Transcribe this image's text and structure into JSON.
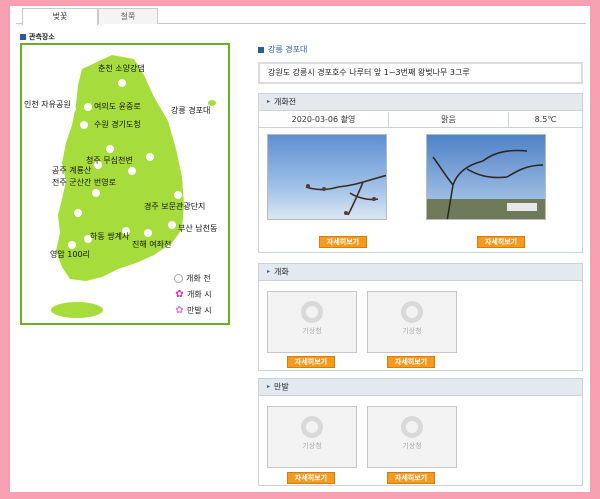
{
  "tabs": [
    {
      "label": "벚꽃",
      "active": true
    },
    {
      "label": "철쭉",
      "active": false
    }
  ],
  "left": {
    "section_label": "관측장소",
    "cities": [
      "춘천 소양강댐",
      "인천 자유공원",
      "여의도 윤중로",
      "강릉 경포대",
      "수원 경기도청",
      "청주 무심천변",
      "공주 계룡산",
      "전주 군산간 번영로",
      "경주 보문관광단지",
      "부산 남천동",
      "하동 쌍계사",
      "진해 여좌천",
      "영암 100리"
    ],
    "legend": [
      {
        "label": "개화 전",
        "marker": "open-circle"
      },
      {
        "label": "개화 시",
        "marker": "flower-icon"
      },
      {
        "label": "만발 시",
        "marker": "flower-icon"
      }
    ],
    "colors": {
      "map_fill": "#a6dd3c",
      "map_border": "#6caf2b",
      "flower": "#d33ab8"
    }
  },
  "right": {
    "title": "강릉 경포대",
    "address": "강원도 강릉시 경포호수 나루터 앞 1~3번째 왕벚나무 3그루",
    "sections": [
      {
        "heading": "개화전",
        "info": {
          "date": "2020-03-06 촬영",
          "weather": "맑음",
          "temp": "8.5℃"
        },
        "items": [
          {
            "button": "자세히보기"
          },
          {
            "button": "자세히보기"
          }
        ]
      },
      {
        "heading": "개화",
        "items": [
          {
            "logo": "기상청",
            "button": "자세히보기"
          },
          {
            "logo": "기상청",
            "button": "자세히보기"
          }
        ]
      },
      {
        "heading": "만발",
        "items": [
          {
            "logo": "기상청",
            "button": "자세히보기"
          },
          {
            "logo": "기상청",
            "button": "자세히보기"
          }
        ]
      }
    ],
    "colors": {
      "accent": "#2a5c9a",
      "button": "#f39a1f",
      "panel_head": "#e4e9ef"
    }
  }
}
